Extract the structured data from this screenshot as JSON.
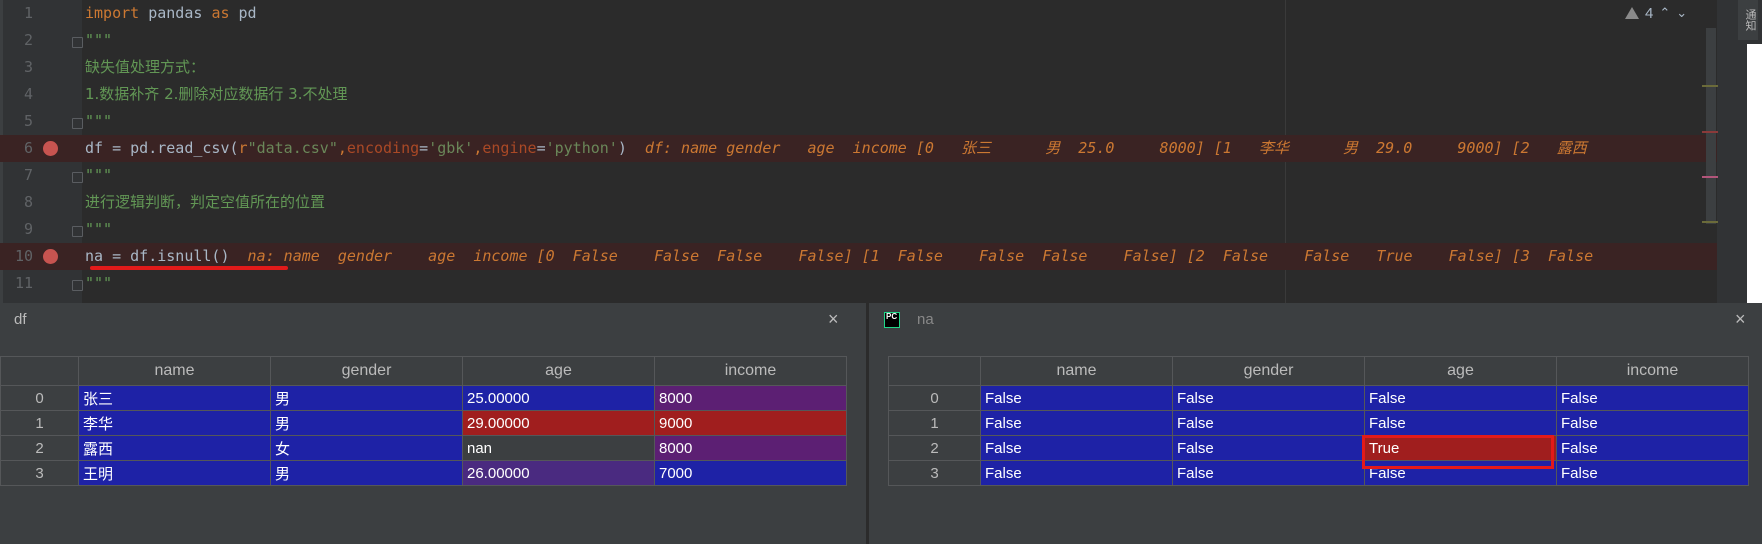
{
  "editor": {
    "lines": [
      {
        "n": "1"
      },
      {
        "n": "2"
      },
      {
        "n": "3"
      },
      {
        "n": "4"
      },
      {
        "n": "5"
      },
      {
        "n": "6"
      },
      {
        "n": "7"
      },
      {
        "n": "8"
      },
      {
        "n": "9"
      },
      {
        "n": "10"
      },
      {
        "n": "11"
      }
    ],
    "code": {
      "l1_import": "import",
      "l1_mod": " pandas ",
      "l1_as": "as",
      "l1_alias": " pd",
      "l2": "\"\"\"",
      "l3": "缺失值处理方式：",
      "l4": "1.数据补齐 2.删除对应数据行 3.不处理",
      "l5": "\"\"\"",
      "l6_a": "df = pd.read_csv(",
      "l6_r": "r",
      "l6_s": "\"data.csv\"",
      "l6_c1": ",",
      "l6_p1": "encoding",
      "l6_eq1": "=",
      "l6_v1": "'gbk'",
      "l6_c2": ",",
      "l6_p2": "engine",
      "l6_eq2": "=",
      "l6_v2": "'python'",
      "l6_close": ")",
      "l6_hint": "  df: name gender   age  income [0   张三      男  25.0     8000] [1   李华      男  29.0     9000] [2   露西",
      "l7": "\"\"\"",
      "l8": "进行逻辑判断，判定空值所在的位置",
      "l9": "\"\"\"",
      "l10_code": "na = df.isnull()",
      "l10_hint": "  na: name  gender    age  income [0  False    False  False    False] [1  False    False  False    False] [2  False    False   True    False] [3  False",
      "l11": "\"\"\""
    },
    "warning_count": "4",
    "side_tab_label": "通知"
  },
  "df_panel": {
    "title": "df",
    "close_icon": "×",
    "columns": [
      "",
      "name",
      "gender",
      "age",
      "income"
    ],
    "rows": [
      {
        "idx": "0",
        "name": "张三",
        "gender": "男",
        "age": "25.00000",
        "income": "8000"
      },
      {
        "idx": "1",
        "name": "李华",
        "gender": "男",
        "age": "29.00000",
        "income": "9000"
      },
      {
        "idx": "2",
        "name": "露西",
        "gender": "女",
        "age": "nan",
        "income": "8000"
      },
      {
        "idx": "3",
        "name": "王明",
        "gender": "男",
        "age": "26.00000",
        "income": "7000"
      }
    ],
    "colors": {
      "blue": "#1e22a6",
      "red": "#a01e1e",
      "purple": "#5c1f73",
      "gray": "#3c3f41"
    }
  },
  "na_panel": {
    "title": "na",
    "icon_label": "PC",
    "close_icon": "×",
    "columns": [
      "",
      "name",
      "gender",
      "age",
      "income"
    ],
    "rows": [
      {
        "idx": "0",
        "name": "False",
        "gender": "False",
        "age": "False",
        "income": "False"
      },
      {
        "idx": "1",
        "name": "False",
        "gender": "False",
        "age": "False",
        "income": "False"
      },
      {
        "idx": "2",
        "name": "False",
        "gender": "False",
        "age": "True",
        "income": "False"
      },
      {
        "idx": "3",
        "name": "False",
        "gender": "False",
        "age": "False",
        "income": "False"
      }
    ]
  }
}
